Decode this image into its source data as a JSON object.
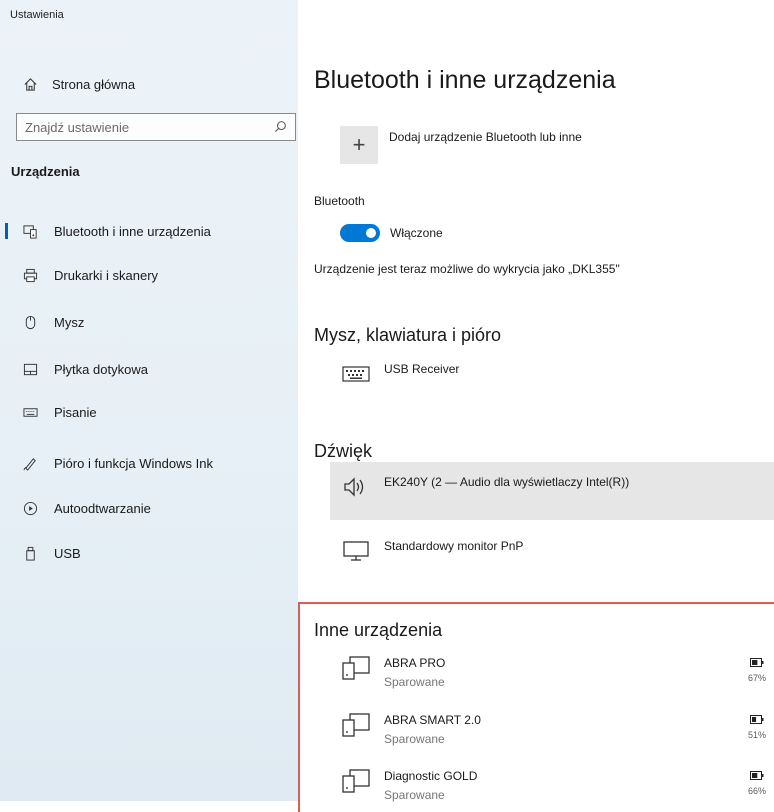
{
  "app_title": "Ustawienia",
  "sidebar": {
    "home_label": "Strona główna",
    "search_placeholder": "Znajdź ustawienie",
    "section_title": "Urządzenia",
    "items": [
      {
        "label": "Bluetooth i inne urządzenia",
        "icon": "bluetooth-devices-icon",
        "active": true
      },
      {
        "label": "Drukarki i skanery",
        "icon": "printer-icon"
      },
      {
        "label": "Mysz",
        "icon": "mouse-icon"
      },
      {
        "label": "Płytka dotykowa",
        "icon": "touchpad-icon"
      },
      {
        "label": "Pisanie",
        "icon": "keyboard-icon"
      },
      {
        "label": "Pióro i funkcja Windows Ink",
        "icon": "pen-icon"
      },
      {
        "label": "Autoodtwarzanie",
        "icon": "autoplay-icon"
      },
      {
        "label": "USB",
        "icon": "usb-icon"
      }
    ]
  },
  "main": {
    "title": "Bluetooth i inne urządzenia",
    "add_device_label": "Dodaj urządzenie Bluetooth lub inne",
    "bluetooth_label": "Bluetooth",
    "toggle_state": "Włączone",
    "toggle_on": true,
    "discoverable_text": "Urządzenie jest teraz możliwe do wykrycia jako „DKL355\"",
    "input_section": {
      "title": "Mysz, klawiatura i pióro",
      "devices": [
        {
          "name": "USB Receiver",
          "icon": "keyboard-icon"
        }
      ]
    },
    "audio_section": {
      "title": "Dźwięk",
      "devices": [
        {
          "name": "EK240Y (2 — Audio dla wyświetlaczy Intel(R))",
          "icon": "speaker-icon",
          "highlighted": true
        },
        {
          "name": "Standardowy monitor PnP",
          "icon": "monitor-icon"
        }
      ]
    },
    "other_section": {
      "title": "Inne urządzenia",
      "devices": [
        {
          "name": "ABRA PRO",
          "status": "Sparowane",
          "battery": "67%",
          "battery_level": 0.67
        },
        {
          "name": "ABRA SMART 2.0",
          "status": "Sparowane",
          "battery": "51%",
          "battery_level": 0.51
        },
        {
          "name": "Diagnostic GOLD",
          "status": "Sparowane",
          "battery": "66%",
          "battery_level": 0.66
        }
      ]
    }
  },
  "colors": {
    "accent": "#0078d4",
    "highlight_border": "#e05a5a"
  }
}
